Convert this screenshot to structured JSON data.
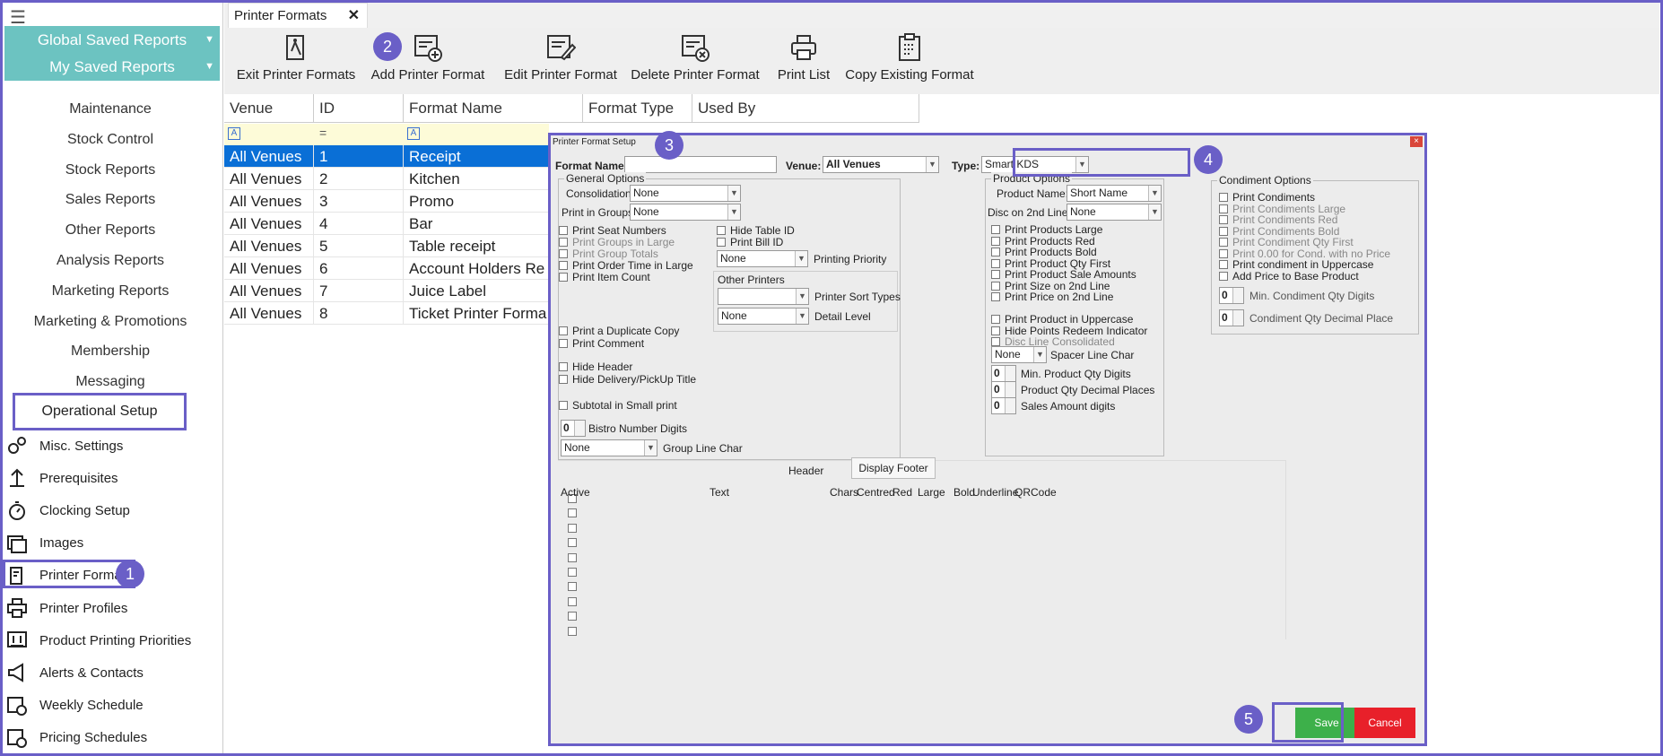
{
  "sidebar": {
    "saved_reports": [
      "Global Saved Reports",
      "My Saved Reports"
    ],
    "menu": [
      "Maintenance",
      "Stock Control",
      "Stock Reports",
      "Sales Reports",
      "Other Reports",
      "Analysis Reports",
      "Marketing Reports",
      "Marketing & Promotions",
      "Membership",
      "Messaging",
      "Operational Setup"
    ],
    "sub_items": [
      {
        "label": "Misc. Settings",
        "icon": "gears-icon"
      },
      {
        "label": "Prerequisites",
        "icon": "prerequisites-icon"
      },
      {
        "label": "Clocking Setup",
        "icon": "stopwatch-icon"
      },
      {
        "label": "Images",
        "icon": "images-icon"
      },
      {
        "label": "Printer Formats",
        "icon": "receipt-icon"
      },
      {
        "label": "Printer Profiles",
        "icon": "printer-icon"
      },
      {
        "label": "Product Printing Priorities",
        "icon": "priority-icon"
      },
      {
        "label": "Alerts & Contacts",
        "icon": "megaphone-icon"
      },
      {
        "label": "Weekly Schedule",
        "icon": "calendar-clock-icon"
      },
      {
        "label": "Pricing Schedules",
        "icon": "calendar-clock-icon"
      }
    ]
  },
  "tab": {
    "label": "Printer Formats",
    "close": "✕"
  },
  "toolbar": [
    "Exit Printer Formats",
    "Add Printer Format",
    "Edit Printer Format",
    "Delete Printer Format",
    "Print List",
    "Copy Existing Format"
  ],
  "grid": {
    "columns": [
      "Venue",
      "ID",
      "Format Name",
      "Format Type",
      "Used By"
    ],
    "rows": [
      [
        "All Venues",
        "1",
        "Receipt"
      ],
      [
        "All Venues",
        "2",
        "Kitchen"
      ],
      [
        "All Venues",
        "3",
        "Promo"
      ],
      [
        "All Venues",
        "4",
        "Bar"
      ],
      [
        "All Venues",
        "5",
        "Table receipt"
      ],
      [
        "All Venues",
        "6",
        "Account Holders Re"
      ],
      [
        "All Venues",
        "7",
        "Juice Label"
      ],
      [
        "All Venues",
        "8",
        "Ticket Printer Forma"
      ]
    ]
  },
  "badges": [
    "1",
    "2",
    "3",
    "4",
    "5"
  ],
  "dialog": {
    "title": "Printer Format Setup",
    "close": "×",
    "format_name_label": "Format Name:",
    "format_name_value": "",
    "venue_label": "Venue:",
    "venue_value": "All Venues",
    "type_label": "Type:",
    "type_value": "Smart KDS",
    "general": {
      "title": "General Options",
      "consolidation_label": "Consolidation:",
      "consolidation_value": "None",
      "groups_label": "Print in Groups:",
      "groups_value": "None",
      "left_checks": [
        {
          "l": "Print Seat Numbers",
          "d": false
        },
        {
          "l": "Print Groups in Large",
          "d": true
        },
        {
          "l": "Print Group Totals",
          "d": true
        },
        {
          "l": "Print Order Time in Large",
          "d": false
        },
        {
          "l": "Print Item Count",
          "d": false
        }
      ],
      "right_checks": [
        "Hide Table ID",
        "Print Bill ID"
      ],
      "priority_value": "None",
      "priority_label": "Printing Priority",
      "other_printers": "Other Printers",
      "sort_label": "Printer Sort Types",
      "sort_value": "",
      "detail_label": "Detail Level",
      "detail_value": "None",
      "checks2": [
        "Print a Duplicate Copy",
        "Print Comment"
      ],
      "checks3": [
        "Hide Header",
        "Hide Delivery/PickUp Title"
      ],
      "checks4": [
        "Subtotal in Small print"
      ],
      "bistro_value": "0",
      "bistro_label": "Bistro Number Digits",
      "group_line_value": "None",
      "group_line_label": "Group Line Char"
    },
    "product": {
      "title": "Product Options",
      "name_label": "Product Name:",
      "name_value": "Short Name",
      "disc_label": "Disc on 2nd Line:",
      "disc_value": "None",
      "checks": [
        "Print Products Large",
        "Print Products Red",
        "Print Products Bold",
        "Print Product Qty First",
        "Print Product Sale Amounts",
        "Print Size on 2nd Line",
        "Print Price on 2nd Line"
      ],
      "checks2": [
        {
          "l": "Print Product in Uppercase",
          "d": false
        },
        {
          "l": "Hide Points Redeem Indicator",
          "d": false
        },
        {
          "l": "Disc Line Consolidated",
          "d": true
        }
      ],
      "spacer_value": "None",
      "spacer_label": "Spacer Line Char",
      "spins": [
        {
          "v": "0",
          "l": "Min. Product Qty Digits"
        },
        {
          "v": "0",
          "l": "Product Qty Decimal Places"
        },
        {
          "v": "0",
          "l": "Sales Amount digits"
        }
      ]
    },
    "condiment": {
      "title": "Condiment Options",
      "checks": [
        {
          "l": "Print Condiments",
          "d": false
        },
        {
          "l": "Print Condiments Large",
          "d": true
        },
        {
          "l": "Print Condiments Red",
          "d": true
        },
        {
          "l": "Print Condiments Bold",
          "d": true
        },
        {
          "l": "Print Condiment Qty First",
          "d": true
        },
        {
          "l": "Print 0.00 for Cond. with no Price",
          "d": true
        },
        {
          "l": "Print condiment in Uppercase",
          "d": false
        },
        {
          "l": "Add Price to Base Product",
          "d": false
        }
      ],
      "spins": [
        {
          "v": "0",
          "l": "Min. Condiment Qty Digits"
        },
        {
          "v": "0",
          "l": "Condiment Qty Decimal Place"
        }
      ]
    },
    "tabs": [
      "Header",
      "Display Footer"
    ],
    "footer_cols": [
      "Active",
      "Text",
      "Chars",
      "Centred",
      "Red",
      "Large",
      "Bold",
      "Underline",
      "QRCode"
    ],
    "save": "Save",
    "cancel": "Cancel"
  }
}
